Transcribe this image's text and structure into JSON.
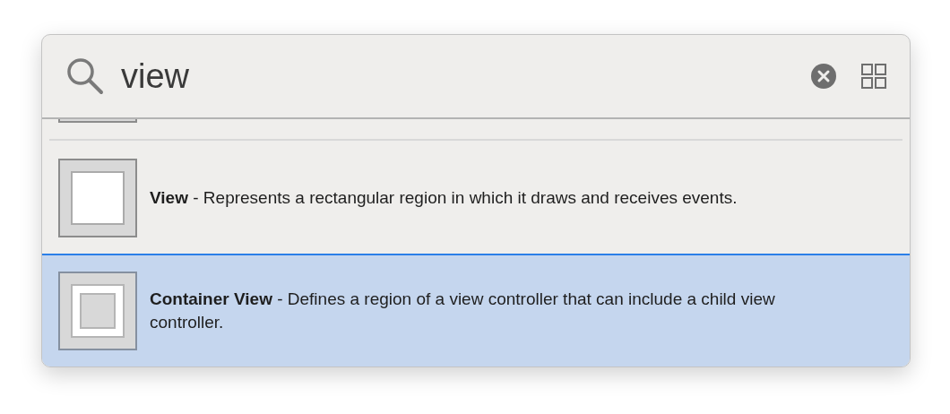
{
  "search": {
    "value": "view"
  },
  "items": [
    {
      "kind": "clipped"
    },
    {
      "kind": "view",
      "selected": false,
      "text": "**View** - Represents a rectangular region in which it draws and receives events."
    },
    {
      "kind": "container",
      "selected": true,
      "text": "**Container View** - Defines a region of a view controller that can include a child view controller."
    }
  ]
}
